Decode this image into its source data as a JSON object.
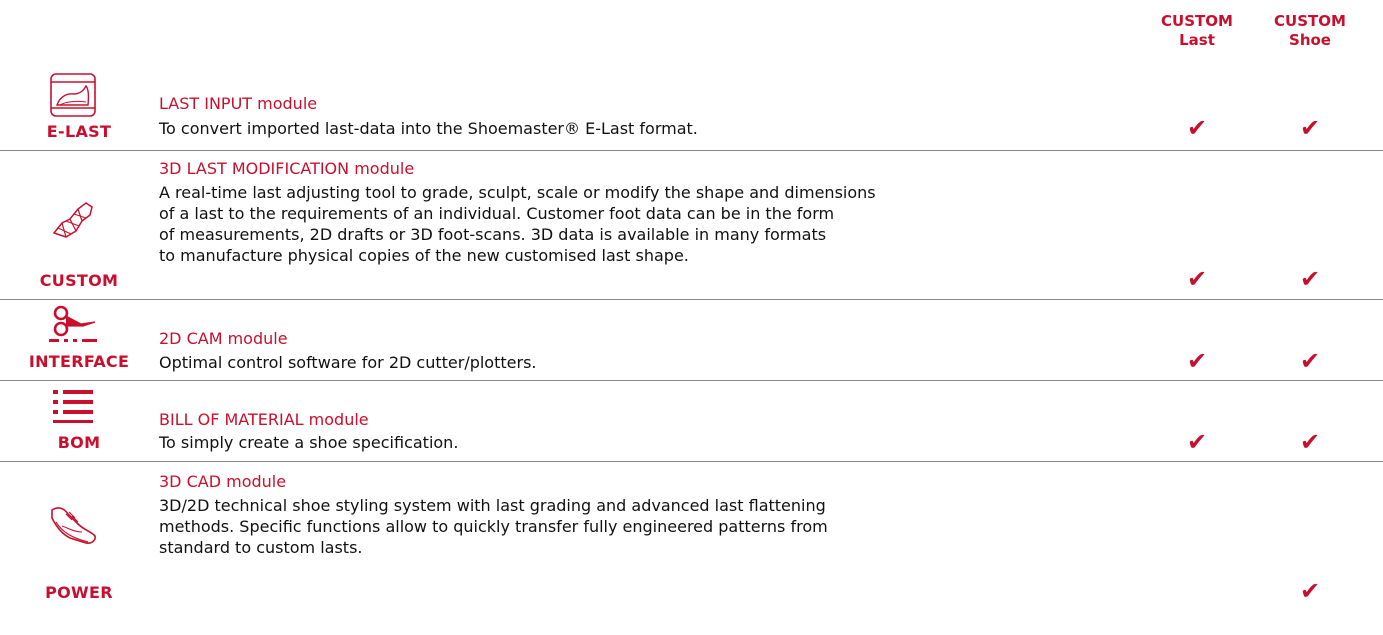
{
  "columns": {
    "custom_last": {
      "line1": "CUSTOM",
      "line2": "Last"
    },
    "custom_shoe": {
      "line1": "CUSTOM",
      "line2": "Shoe"
    }
  },
  "check_glyph": "✔",
  "accent_color": "#c8102e",
  "modules": [
    {
      "tag": "E-LAST",
      "icon": "last-box-icon",
      "title": "LAST INPUT module",
      "description": "To convert imported last-data into the Shoemaster® E-Last format.",
      "custom_last": true,
      "custom_shoe": true
    },
    {
      "tag": "CUSTOM",
      "icon": "last-sculpt-icon",
      "title": "3D LAST MODIFICATION module",
      "description": "A real-time last adjusting tool to grade, sculpt, scale or modify the shape and dimensions\nof a last to the requirements of an individual. Customer foot data can be in the form\nof measurements, 2D drafts or 3D foot-scans. 3D data is available in many formats\nto manufacture physical copies of the new customised last shape.",
      "custom_last": true,
      "custom_shoe": true
    },
    {
      "tag": "INTERFACE",
      "icon": "scissors-cut-icon",
      "title": "2D CAM module",
      "description": "Optimal control software for 2D cutter/plotters.",
      "custom_last": true,
      "custom_shoe": true
    },
    {
      "tag": "BOM",
      "icon": "list-icon",
      "title": "BILL OF MATERIAL module",
      "description": "To simply create a shoe specification.",
      "custom_last": true,
      "custom_shoe": true
    },
    {
      "tag": "POWER",
      "icon": "shoe-icon",
      "title": "3D CAD module",
      "description": "3D/2D technical shoe styling system with last grading and advanced last flattening\nmethods. Specific functions allow to quickly transfer fully engineered patterns from\nstandard to custom lasts.",
      "custom_last": false,
      "custom_shoe": true
    }
  ]
}
